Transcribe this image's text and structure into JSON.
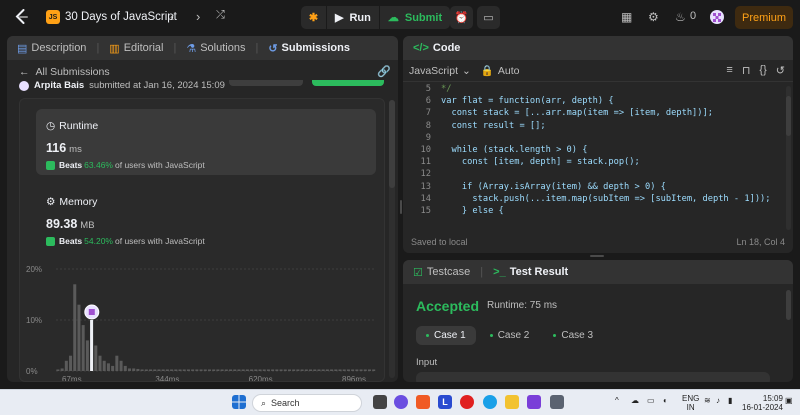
{
  "topbar": {
    "js_badge": "JS",
    "problem_title": "30 Days of JavaScript",
    "run_label": "Run",
    "submit_label": "Submit",
    "streak_count": "0",
    "premium_label": "Premium"
  },
  "left": {
    "tabs": [
      "Description",
      "Editorial",
      "Solutions",
      "Submissions"
    ],
    "all_submissions": "All Submissions",
    "author": "Arpita Bais",
    "submitted_at": "submitted at Jan 16, 2024 15:09",
    "runtime": {
      "label": "Runtime",
      "value": "116",
      "unit": "ms",
      "beats_label": "Beats",
      "beats_pct": "63.46%",
      "beats_suffix": "of users with JavaScript"
    },
    "memory": {
      "label": "Memory",
      "value": "89.38",
      "unit": "MB",
      "beats_label": "Beats",
      "beats_pct": "54.20%",
      "beats_suffix": "of users with JavaScript"
    }
  },
  "chart_data": {
    "type": "bar",
    "y_ticks": [
      "20%",
      "10%",
      "0%"
    ],
    "x_ticks": [
      "67ms",
      "344ms",
      "620ms",
      "896ms"
    ],
    "ylim": [
      0,
      20
    ],
    "highlight_bin": 8,
    "values": [
      0.3,
      0.5,
      2,
      3,
      17,
      13,
      9,
      6,
      10,
      5,
      3,
      2,
      1.5,
      1,
      3,
      2,
      1,
      0.5,
      0.5,
      0.4,
      0.3,
      0.3,
      0.3,
      0.3,
      0.3,
      0.3,
      0.3,
      0.3,
      0.3,
      0.3,
      0.3,
      0.3,
      0.3,
      0.3,
      0.3,
      0.3,
      0.3,
      0.3,
      0.3,
      0.3,
      0.3,
      0.3,
      0.3,
      0.3,
      0.3,
      0.3,
      0.3,
      0.3,
      0.3,
      0.3,
      0.3,
      0.3,
      0.3,
      0.3,
      0.3,
      0.3,
      0.3,
      0.3,
      0.3,
      0.3,
      0.3,
      0.3,
      0.3,
      0.3,
      0.3,
      0.3,
      0.3,
      0.3,
      0.3,
      0.3,
      0.3,
      0.3,
      0.3,
      0.3,
      0.3,
      0.3
    ]
  },
  "code": {
    "title": "Code",
    "language": "JavaScript",
    "mode": "Auto",
    "lines": [
      {
        "n": "5",
        "t": "*/"
      },
      {
        "n": "6",
        "t": "var flat = function(arr, depth) {"
      },
      {
        "n": "7",
        "t": "  const stack = [...arr.map(item => [item, depth])];"
      },
      {
        "n": "8",
        "t": "  const result = [];"
      },
      {
        "n": "9",
        "t": ""
      },
      {
        "n": "10",
        "t": "  while (stack.length > 0) {"
      },
      {
        "n": "11",
        "t": "    const [item, depth] = stack.pop();"
      },
      {
        "n": "12",
        "t": ""
      },
      {
        "n": "13",
        "t": "    if (Array.isArray(item) && depth > 0) {"
      },
      {
        "n": "14",
        "t": "      stack.push(...item.map(subItem => [subItem, depth - 1]));"
      },
      {
        "n": "15",
        "t": "    } else {"
      }
    ],
    "saved": "Saved to local",
    "cursor": "Ln 18, Col 4"
  },
  "result": {
    "tabs": [
      "Testcase",
      "Test Result"
    ],
    "status": "Accepted",
    "runtime": "Runtime: 75 ms",
    "cases": [
      "Case 1",
      "Case 2",
      "Case 3"
    ],
    "input_label": "Input"
  },
  "taskbar": {
    "search_placeholder": "Search",
    "lang": "ENG",
    "region": "IN",
    "time": "15:09",
    "date": "16-01-2024"
  }
}
